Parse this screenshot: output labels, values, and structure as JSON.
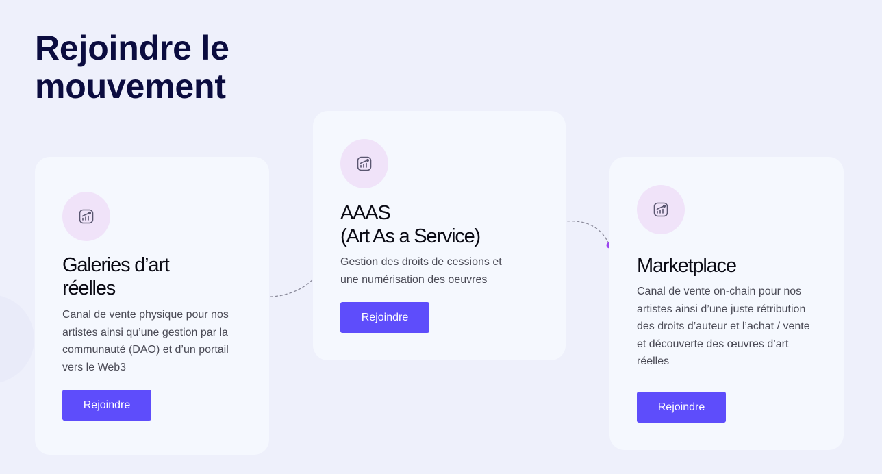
{
  "header": {
    "title_line1": "Rejoindre le",
    "title_line2": "mouvement"
  },
  "colors": {
    "background": "#eef0fb",
    "title": "#0b0c3f",
    "card": "#f5f8fe",
    "icon_bg": "#f0e3f9",
    "button": "#5e4dfb",
    "dot_blue": "#5b4ef0",
    "dot_orange": "#f26b4f",
    "dot_purple": "#9b45ef"
  },
  "cards": [
    {
      "icon": "chart-growth-icon",
      "title_line1": "Galeries d’art",
      "title_line2": "réelles",
      "description": "Canal de vente physique pour nos artistes ainsi qu’une gestion par la communauté (DAO) et d’un portail vers le Web3",
      "button_label": "Rejoindre"
    },
    {
      "icon": "chart-growth-icon",
      "title_line1": "AAAS",
      "title_line2": "(Art As a Service)",
      "description": "Gestion des droits de cessions et une numérisation des oeuvres",
      "button_label": "Rejoindre"
    },
    {
      "icon": "chart-growth-icon",
      "title_line1": "Marketplace",
      "title_line2": "",
      "description": "Canal de vente on-chain pour nos artistes ainsi d’une juste rétribution des droits d’auteur et l’achat / vente et découverte des œuvres d’art réelles",
      "button_label": "Rejoindre"
    }
  ]
}
